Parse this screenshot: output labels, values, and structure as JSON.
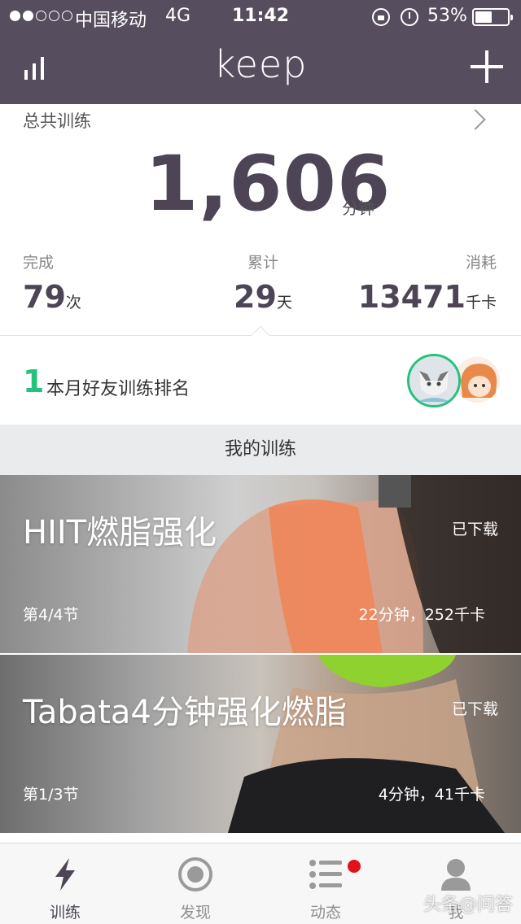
{
  "status_bar": {
    "carrier": "中国移动",
    "network": "4G",
    "time": "11:42",
    "battery_pct": "53%",
    "battery_level": 0.53
  },
  "header": {
    "logo": "keep"
  },
  "summary": {
    "total_label": "总共训练",
    "total_value": "1,606",
    "total_unit": "分钟",
    "stats": {
      "completed_label": "完成",
      "completed_value": "79",
      "completed_unit": "次",
      "days_label": "累计",
      "days_value": "29",
      "days_unit": "天",
      "calories_label": "消耗",
      "calories_value": "13471",
      "calories_unit": "千卡"
    }
  },
  "ranking": {
    "rank": "1",
    "label": "本月好友训练排名"
  },
  "my_training": {
    "title": "我的训练",
    "courses": [
      {
        "title": "HIIT燃脂强化",
        "status": "已下载",
        "section": "第4/4节",
        "meta": "22分钟，252千卡"
      },
      {
        "title": "Tabata4分钟强化燃脂",
        "status": "已下载",
        "section": "第1/3节",
        "meta": "4分钟，41千卡"
      }
    ]
  },
  "tabbar": {
    "tabs": [
      {
        "label": "训练",
        "icon": "lightning-icon"
      },
      {
        "label": "发现",
        "icon": "target-icon"
      },
      {
        "label": "动态",
        "icon": "feed-list-icon"
      },
      {
        "label": "我",
        "icon": "person-icon"
      }
    ]
  },
  "watermark": "头条@问答",
  "colors": {
    "header_bg": "#564d5f",
    "accent_green": "#24c27c",
    "number_color": "#4d4555",
    "badge_red": "#e3111b"
  }
}
